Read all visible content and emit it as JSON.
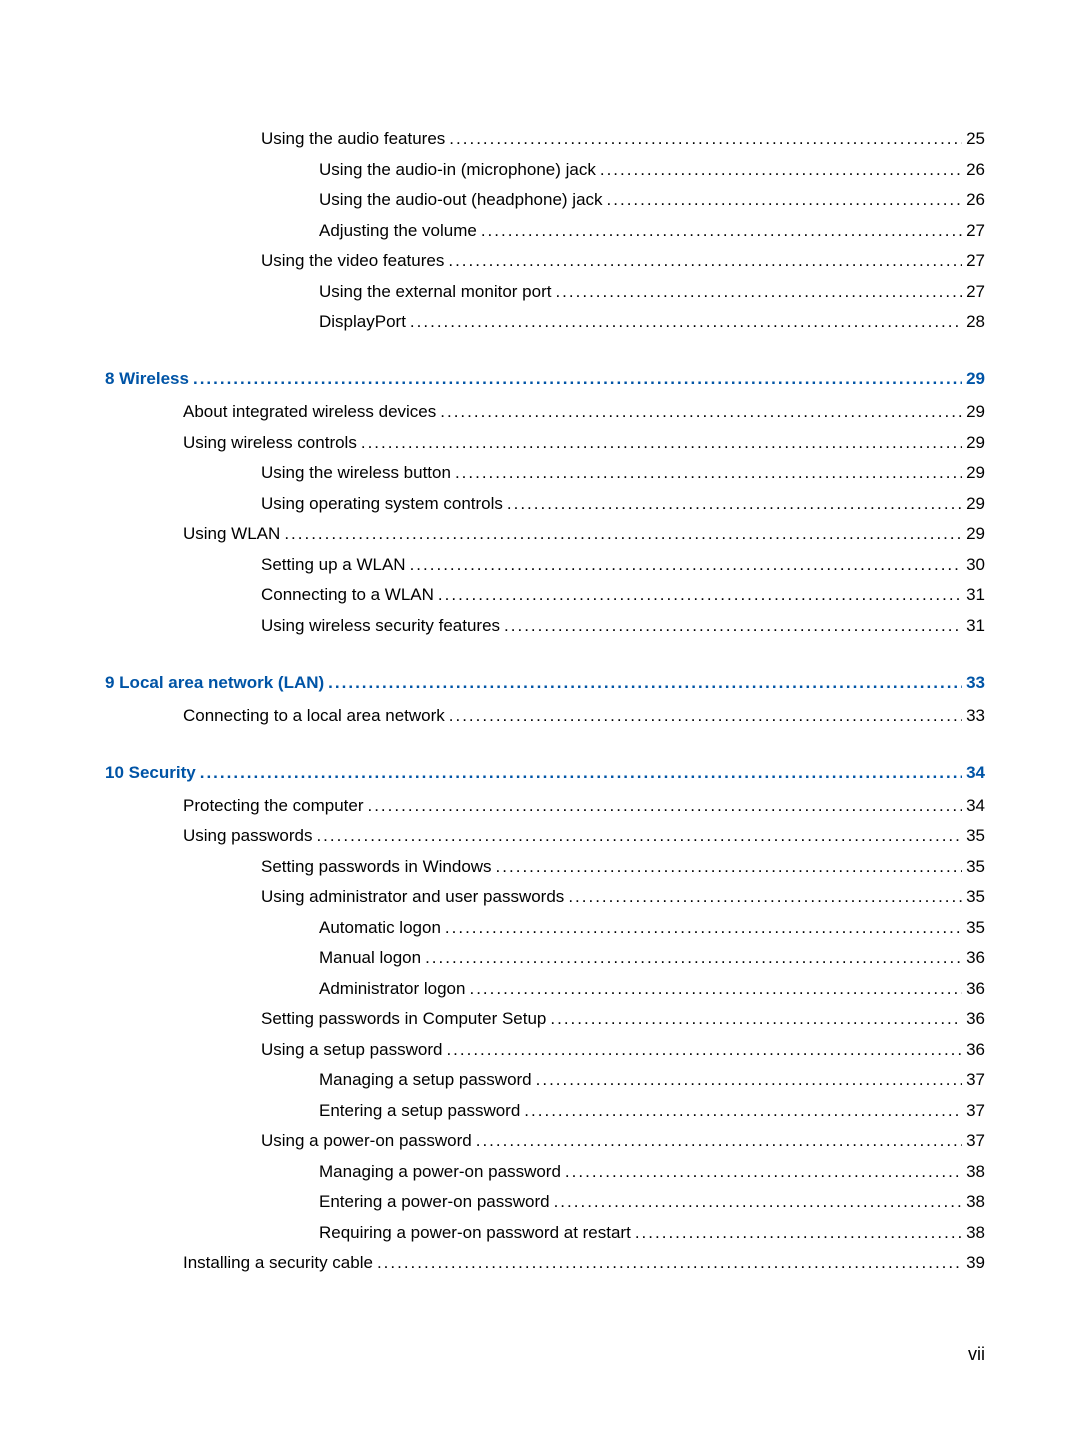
{
  "footer": "vii",
  "entries": [
    {
      "level": 2,
      "text": "Using the audio features",
      "page": "25",
      "chapter": false
    },
    {
      "level": 3,
      "text": "Using the audio-in (microphone) jack",
      "page": "26",
      "chapter": false
    },
    {
      "level": 3,
      "text": "Using the audio-out (headphone) jack",
      "page": "26",
      "chapter": false
    },
    {
      "level": 3,
      "text": "Adjusting the volume",
      "page": "27",
      "chapter": false
    },
    {
      "level": 2,
      "text": "Using the video features",
      "page": "27",
      "chapter": false
    },
    {
      "level": 3,
      "text": "Using the external monitor port",
      "page": "27",
      "chapter": false
    },
    {
      "level": 3,
      "text": "DisplayPort",
      "page": "28",
      "chapter": false
    },
    {
      "level": 0,
      "text": "8  Wireless",
      "page": "29",
      "chapter": true
    },
    {
      "level": 1,
      "text": "About integrated wireless devices",
      "page": "29",
      "chapter": false
    },
    {
      "level": 1,
      "text": "Using wireless controls",
      "page": "29",
      "chapter": false
    },
    {
      "level": 2,
      "text": "Using the wireless button",
      "page": "29",
      "chapter": false
    },
    {
      "level": 2,
      "text": "Using operating system controls",
      "page": "29",
      "chapter": false
    },
    {
      "level": 1,
      "text": "Using WLAN",
      "page": "29",
      "chapter": false
    },
    {
      "level": 2,
      "text": "Setting up a WLAN",
      "page": "30",
      "chapter": false
    },
    {
      "level": 2,
      "text": "Connecting to a WLAN",
      "page": "31",
      "chapter": false
    },
    {
      "level": 2,
      "text": "Using wireless security features",
      "page": "31",
      "chapter": false
    },
    {
      "level": 0,
      "text": "9  Local area network (LAN)",
      "page": "33",
      "chapter": true
    },
    {
      "level": 1,
      "text": "Connecting to a local area network",
      "page": "33",
      "chapter": false
    },
    {
      "level": 0,
      "text": "10  Security",
      "page": "34",
      "chapter": true
    },
    {
      "level": 1,
      "text": "Protecting the computer",
      "page": "34",
      "chapter": false
    },
    {
      "level": 1,
      "text": "Using passwords",
      "page": "35",
      "chapter": false
    },
    {
      "level": 2,
      "text": "Setting passwords in Windows",
      "page": "35",
      "chapter": false
    },
    {
      "level": 2,
      "text": "Using administrator and user passwords",
      "page": "35",
      "chapter": false
    },
    {
      "level": 3,
      "text": "Automatic logon",
      "page": "35",
      "chapter": false
    },
    {
      "level": 3,
      "text": "Manual logon",
      "page": "36",
      "chapter": false
    },
    {
      "level": 3,
      "text": "Administrator logon",
      "page": "36",
      "chapter": false
    },
    {
      "level": 2,
      "text": "Setting passwords in Computer Setup",
      "page": "36",
      "chapter": false
    },
    {
      "level": 2,
      "text": "Using a setup password",
      "page": "36",
      "chapter": false
    },
    {
      "level": 3,
      "text": "Managing a setup password",
      "page": "37",
      "chapter": false
    },
    {
      "level": 3,
      "text": "Entering a setup password",
      "page": "37",
      "chapter": false
    },
    {
      "level": 2,
      "text": "Using a power-on password",
      "page": "37",
      "chapter": false
    },
    {
      "level": 3,
      "text": "Managing a power-on password",
      "page": "38",
      "chapter": false
    },
    {
      "level": 3,
      "text": "Entering a power-on password",
      "page": "38",
      "chapter": false
    },
    {
      "level": 3,
      "text": "Requiring a power-on password at restart",
      "page": "38",
      "chapter": false
    },
    {
      "level": 1,
      "text": "Installing a security cable",
      "page": "39",
      "chapter": false
    }
  ]
}
